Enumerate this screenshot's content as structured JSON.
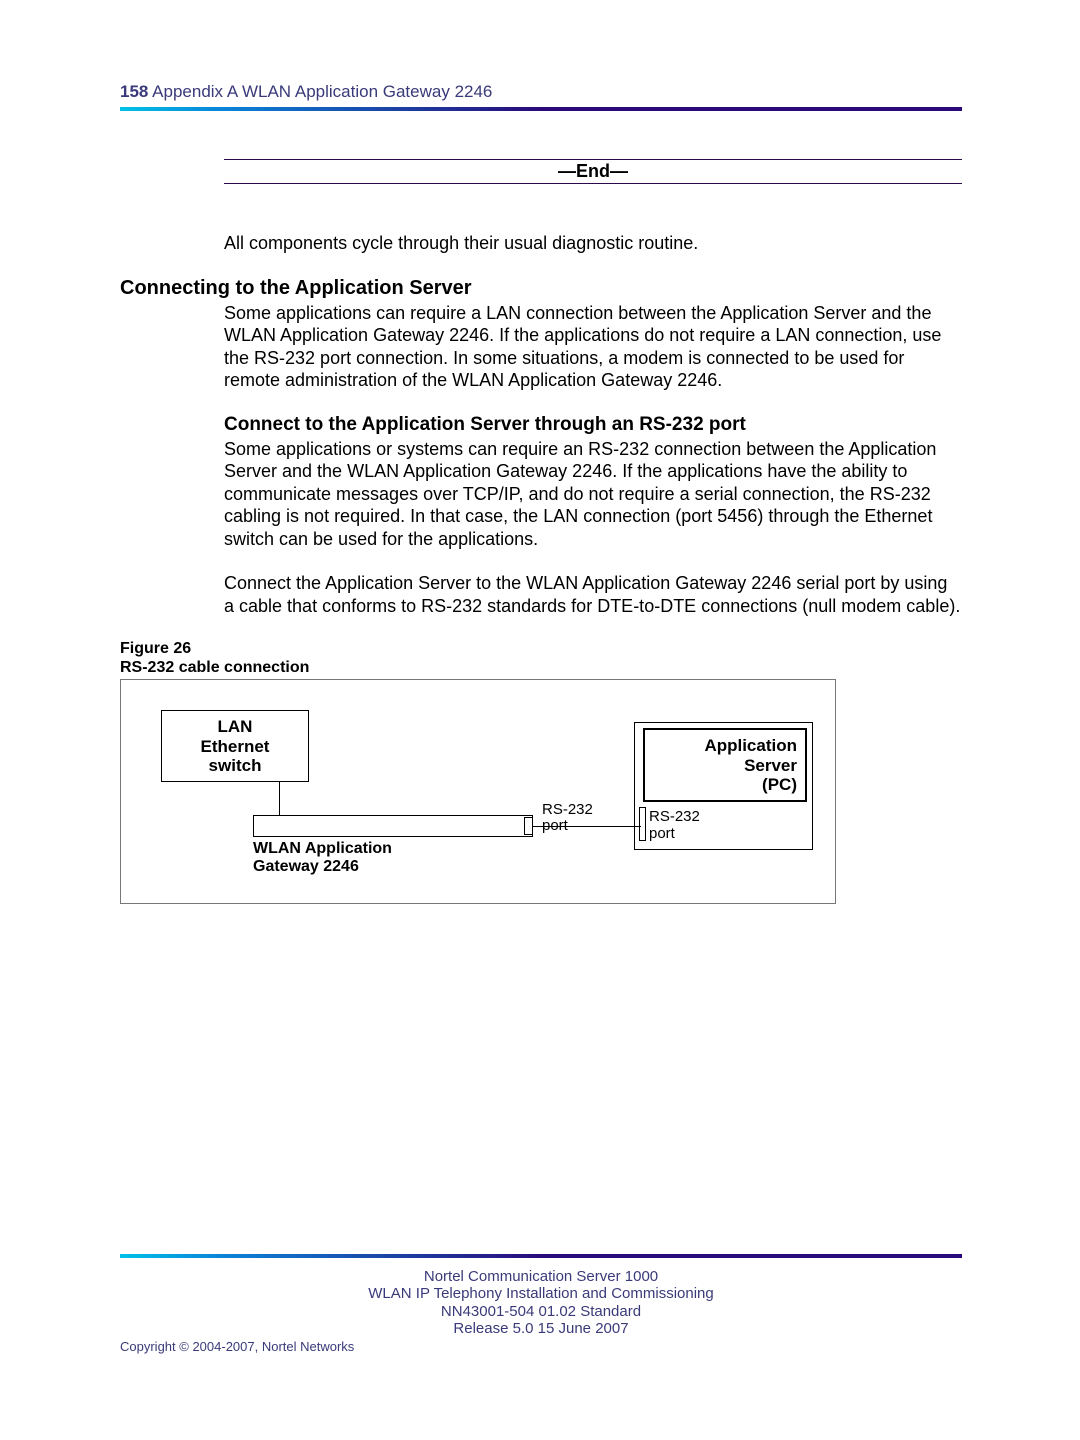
{
  "header": {
    "page_num": "158",
    "appendix": "Appendix A  WLAN Application Gateway 2246"
  },
  "end_marker": "—End—",
  "para1": "All components cycle through their usual diagnostic routine.",
  "section1": {
    "title": "Connecting to the Application Server",
    "para": "Some applications can require a LAN connection between the Application Server and the WLAN Application Gateway 2246. If the applications do not require a LAN connection, use the RS-232 port connection. In some situations, a modem is connected to be used for remote administration of the WLAN Application Gateway 2246."
  },
  "section2": {
    "title": "Connect to the Application Server through an RS-232 port",
    "para1": "Some applications or systems can require an RS-232 connection between the Application Server and the WLAN Application Gateway 2246. If the applications have the ability to communicate messages over TCP/IP, and do not require a serial connection, the RS-232 cabling is not required. In that case, the LAN connection (port 5456) through the Ethernet switch can be used for the applications.",
    "para2": "Connect the Application Server to the WLAN Application Gateway 2246 serial port by using a cable that conforms to RS-232 standards for DTE-to-DTE connections (null modem cable)."
  },
  "figure": {
    "label": "Figure 26",
    "title": "RS-232 cable connection",
    "lan_l1": "LAN",
    "lan_l2": "Ethernet",
    "lan_l3": "switch",
    "app_l1": "Application",
    "app_l2": "Server",
    "app_l3": "(PC)",
    "app_port": "RS-232\nport",
    "wlan_port": "RS-232\nport",
    "wlan_label_l1": "WLAN Application",
    "wlan_label_l2": "Gateway 2246"
  },
  "footer": {
    "l1": "Nortel Communication Server 1000",
    "l2": "WLAN IP Telephony Installation and Commissioning",
    "l3": "NN43001-504   01.02   Standard",
    "l4": "Release 5.0    15 June 2007",
    "copyright": "Copyright © 2004-2007, Nortel Networks"
  }
}
